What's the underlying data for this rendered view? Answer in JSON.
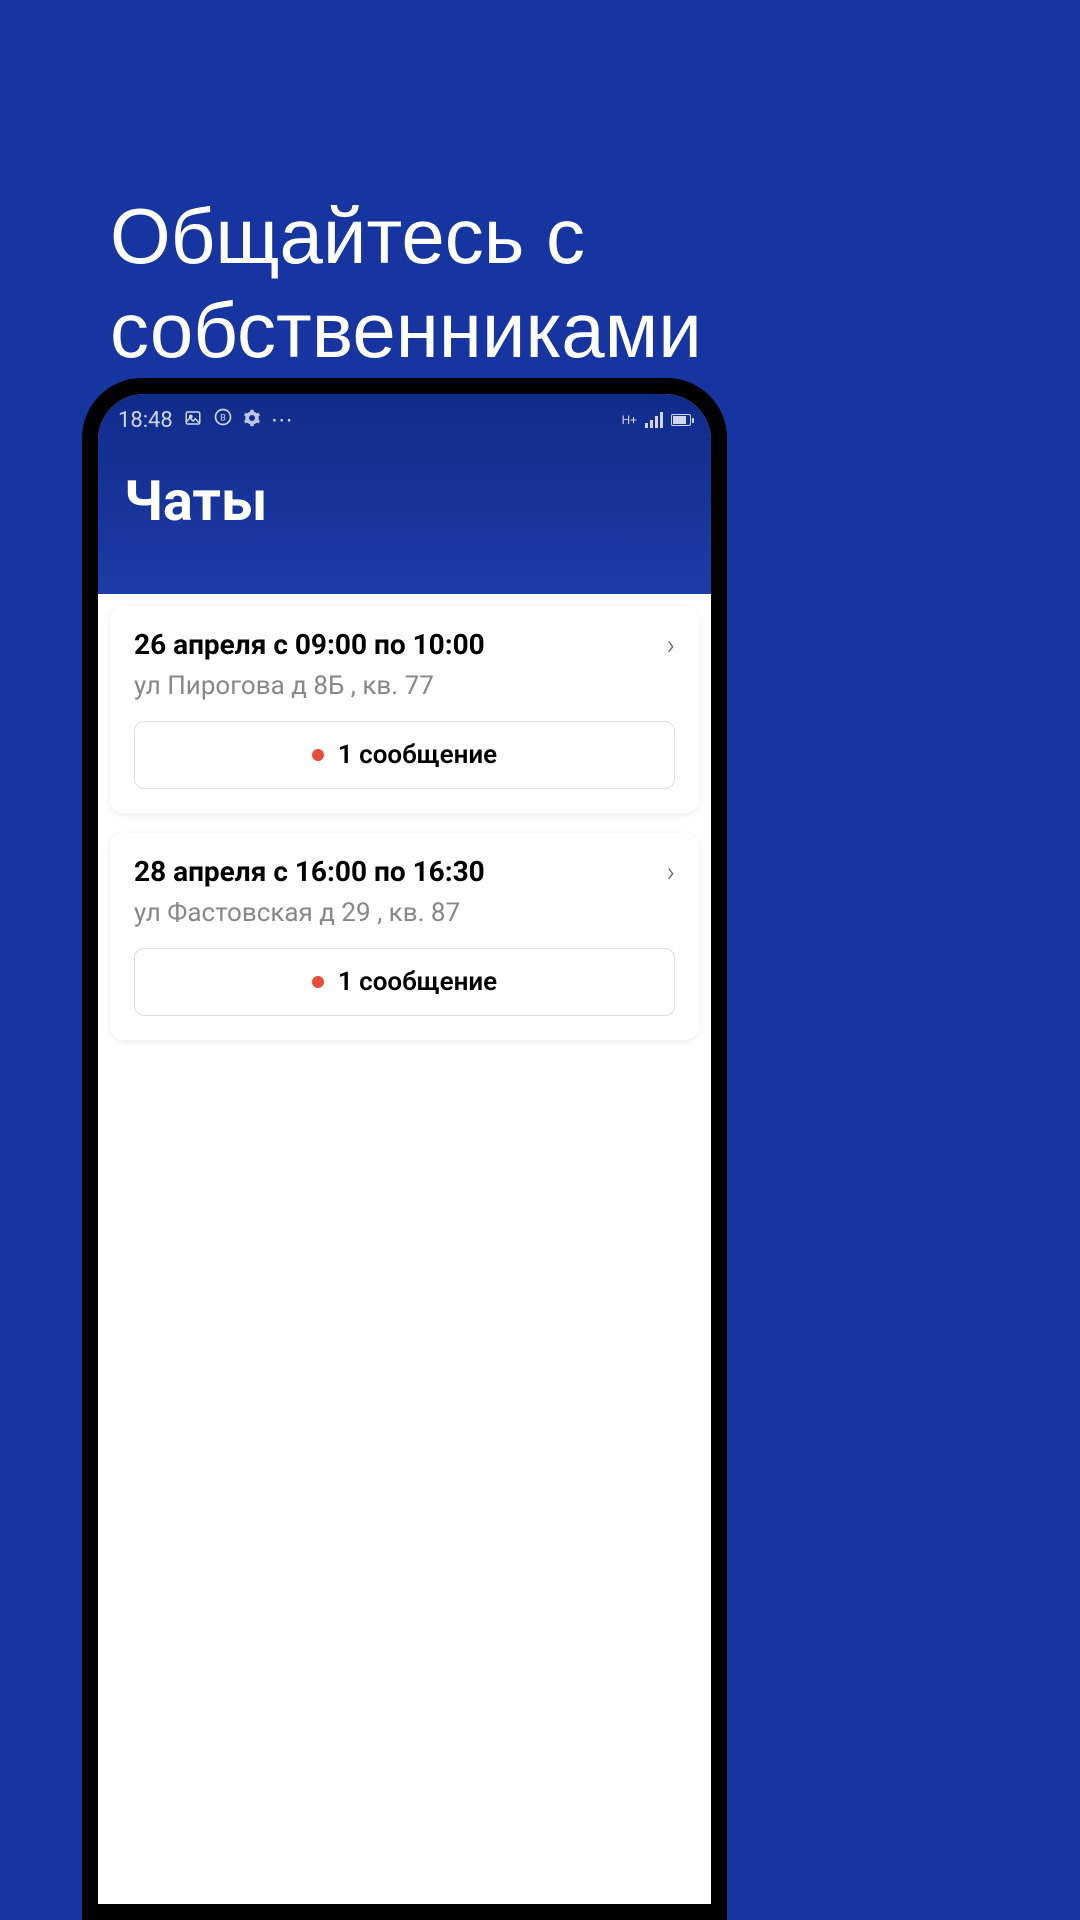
{
  "promo": {
    "line1": "Общайтесь с",
    "line2": "собственниками"
  },
  "status_bar": {
    "time": "18:48",
    "network": "H+"
  },
  "header": {
    "title": "Чаты"
  },
  "chats": [
    {
      "title": "26 апреля с 09:00 по 10:00",
      "address": "ул Пирогова д 8Б , кв. 77",
      "message_label": "1 сообщение"
    },
    {
      "title": "28 апреля с 16:00 по 16:30",
      "address": "ул Фастовская д 29 , кв. 87",
      "message_label": "1 сообщение"
    }
  ]
}
